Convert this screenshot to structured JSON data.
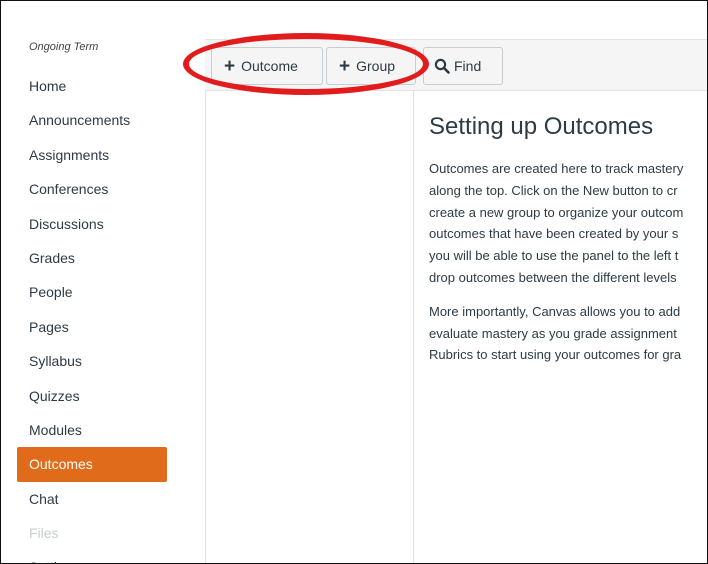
{
  "sidebar": {
    "term_label": "Ongoing Term",
    "items": [
      {
        "label": "Home"
      },
      {
        "label": "Announcements"
      },
      {
        "label": "Assignments"
      },
      {
        "label": "Conferences"
      },
      {
        "label": "Discussions"
      },
      {
        "label": "Grades"
      },
      {
        "label": "People"
      },
      {
        "label": "Pages"
      },
      {
        "label": "Syllabus"
      },
      {
        "label": "Quizzes"
      },
      {
        "label": "Modules"
      },
      {
        "label": "Outcomes",
        "active": true
      },
      {
        "label": "Chat"
      },
      {
        "label": "Files",
        "disabled": true
      },
      {
        "label": "Settings"
      }
    ]
  },
  "toolbar": {
    "outcome_label": "Outcome",
    "group_label": "Group",
    "find_label": "Find",
    "plus_glyph": "+"
  },
  "main": {
    "title": "Setting up Outcomes",
    "paragraph1_lines": [
      "Outcomes are created here to track mastery",
      "along the top. Click on the New button to cr",
      "create a new group to organize your outcom",
      "outcomes that have been created by your s",
      "you will be able to use the panel to the left t",
      "drop outcomes between the different levels"
    ],
    "paragraph2_lines": [
      "More importantly, Canvas allows you to add",
      "evaluate mastery as you grade assignment",
      "Rubrics to start using your outcomes for gra"
    ]
  },
  "colors": {
    "active_nav": "#e06b1b",
    "highlight_ring": "#e21c1c",
    "toolbar_bg": "#f5f5f5"
  },
  "icons": {
    "find": "search-icon",
    "add": "plus-icon"
  }
}
